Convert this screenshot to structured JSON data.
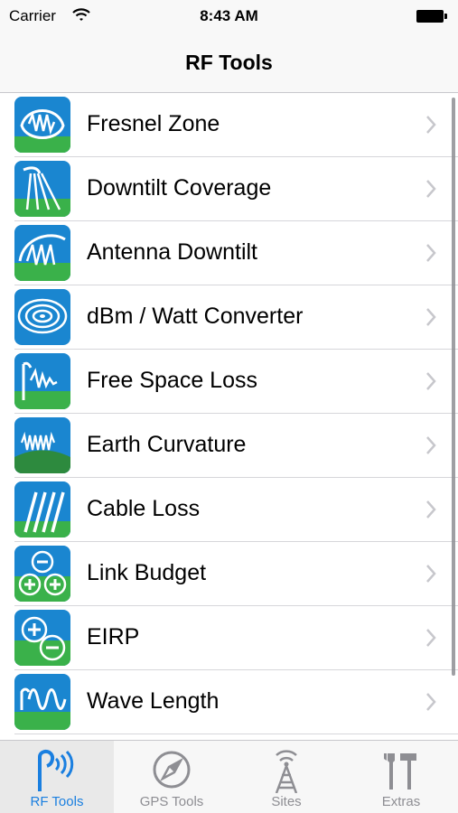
{
  "status_bar": {
    "carrier": "Carrier",
    "time": "8:43 AM"
  },
  "nav": {
    "title": "RF Tools"
  },
  "items": [
    {
      "label": "Fresnel Zone",
      "icon": "fresnel-zone-icon"
    },
    {
      "label": "Downtilt Coverage",
      "icon": "downtilt-coverage-icon"
    },
    {
      "label": "Antenna Downtilt",
      "icon": "antenna-downtilt-icon"
    },
    {
      "label": "dBm / Watt Converter",
      "icon": "dbm-watt-icon"
    },
    {
      "label": "Free Space Loss",
      "icon": "free-space-loss-icon"
    },
    {
      "label": "Earth Curvature",
      "icon": "earth-curvature-icon"
    },
    {
      "label": "Cable Loss",
      "icon": "cable-loss-icon"
    },
    {
      "label": "Link Budget",
      "icon": "link-budget-icon"
    },
    {
      "label": "EIRP",
      "icon": "eirp-icon"
    },
    {
      "label": "Wave Length",
      "icon": "wave-length-icon"
    }
  ],
  "tabs": [
    {
      "label": "RF Tools",
      "icon": "rf-signal-icon",
      "active": true
    },
    {
      "label": "GPS Tools",
      "icon": "compass-icon",
      "active": false
    },
    {
      "label": "Sites",
      "icon": "tower-icon",
      "active": false
    },
    {
      "label": "Extras",
      "icon": "tools-icon",
      "active": false
    }
  ],
  "colors": {
    "accent": "#1a7fe0",
    "inactive": "#8e8e93",
    "icon_blue": "#1a86d0",
    "icon_green": "#3ab14a"
  }
}
